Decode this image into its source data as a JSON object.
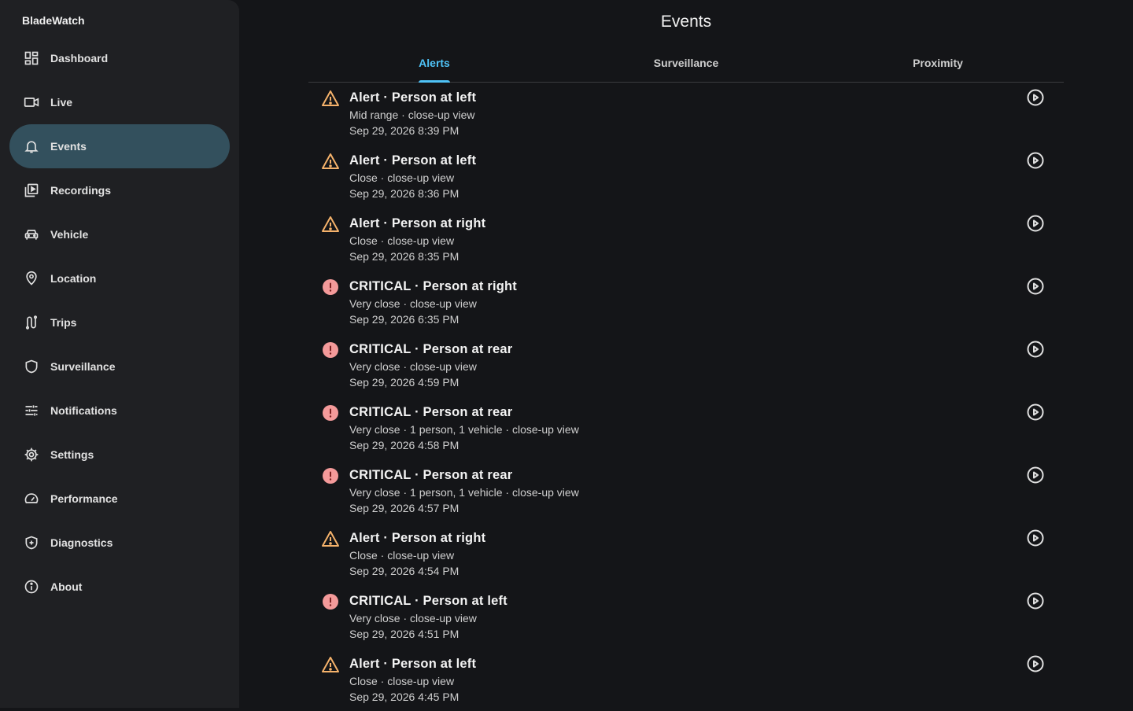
{
  "app": {
    "title": "BladeWatch"
  },
  "sidebar": {
    "items": [
      {
        "label": "Dashboard",
        "icon": "dashboard-icon",
        "active": false
      },
      {
        "label": "Live",
        "icon": "video-camera-icon",
        "active": false
      },
      {
        "label": "Events",
        "icon": "bell-icon",
        "active": true
      },
      {
        "label": "Recordings",
        "icon": "recordings-icon",
        "active": false
      },
      {
        "label": "Vehicle",
        "icon": "car-icon",
        "active": false
      },
      {
        "label": "Location",
        "icon": "location-pin-icon",
        "active": false
      },
      {
        "label": "Trips",
        "icon": "route-icon",
        "active": false
      },
      {
        "label": "Surveillance",
        "icon": "shield-icon",
        "active": false
      },
      {
        "label": "Notifications",
        "icon": "sliders-icon",
        "active": false
      },
      {
        "label": "Settings",
        "icon": "gear-icon",
        "active": false
      },
      {
        "label": "Performance",
        "icon": "speedometer-icon",
        "active": false
      },
      {
        "label": "Diagnostics",
        "icon": "shield-plus-icon",
        "active": false
      },
      {
        "label": "About",
        "icon": "info-icon",
        "active": false
      }
    ]
  },
  "main": {
    "title": "Events",
    "tabs": [
      {
        "label": "Alerts",
        "active": true
      },
      {
        "label": "Surveillance",
        "active": false
      },
      {
        "label": "Proximity",
        "active": false
      }
    ],
    "events": [
      {
        "severity": "alert",
        "title": "Alert · Person at left",
        "subtitle": "Mid range · close-up view",
        "time": "Sep 29, 2026 8:39 PM"
      },
      {
        "severity": "alert",
        "title": "Alert · Person at left",
        "subtitle": "Close · close-up view",
        "time": "Sep 29, 2026 8:36 PM"
      },
      {
        "severity": "alert",
        "title": "Alert · Person at right",
        "subtitle": "Close · close-up view",
        "time": "Sep 29, 2026 8:35 PM"
      },
      {
        "severity": "critical",
        "title": "CRITICAL · Person at right",
        "subtitle": "Very close · close-up view",
        "time": "Sep 29, 2026 6:35 PM"
      },
      {
        "severity": "critical",
        "title": "CRITICAL · Person at rear",
        "subtitle": "Very close · close-up view",
        "time": "Sep 29, 2026 4:59 PM"
      },
      {
        "severity": "critical",
        "title": "CRITICAL · Person at rear",
        "subtitle": "Very close · 1 person, 1 vehicle · close-up view",
        "time": "Sep 29, 2026 4:58 PM"
      },
      {
        "severity": "critical",
        "title": "CRITICAL · Person at rear",
        "subtitle": "Very close · 1 person, 1 vehicle · close-up view",
        "time": "Sep 29, 2026 4:57 PM"
      },
      {
        "severity": "alert",
        "title": "Alert · Person at right",
        "subtitle": "Close · close-up view",
        "time": "Sep 29, 2026 4:54 PM"
      },
      {
        "severity": "critical",
        "title": "CRITICAL · Person at left",
        "subtitle": "Very close · close-up view",
        "time": "Sep 29, 2026 4:51 PM"
      },
      {
        "severity": "alert",
        "title": "Alert · Person at left",
        "subtitle": "Close · close-up view",
        "time": "Sep 29, 2026 4:45 PM"
      }
    ]
  },
  "colors": {
    "accent": "#4fc3f7",
    "alert": "#f5b26b",
    "critical": "#f49a9a",
    "active_nav": "#33505d"
  }
}
